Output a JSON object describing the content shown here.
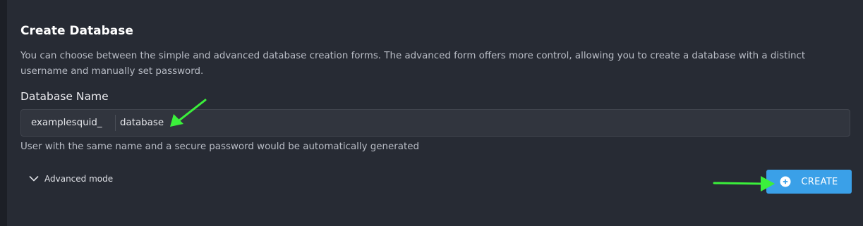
{
  "card": {
    "title": "Create Database",
    "description": "You can choose between the simple and advanced database creation forms. The advanced form offers more control, allowing you to create a database with a distinct username and manually set password."
  },
  "form": {
    "field_label": "Database Name",
    "prefix": "examplesquid_",
    "value": "database",
    "hint": "User with the same name and a secure password would be automatically generated"
  },
  "advanced": {
    "label": "Advanced mode",
    "icon": "chevron-down-icon"
  },
  "create_button": {
    "label": "CREATE",
    "icon": "plus-circle-icon"
  },
  "colors": {
    "accent": "#3aa0e8",
    "panel_bg": "#272b34",
    "annotation_arrow": "#3bf03b"
  }
}
